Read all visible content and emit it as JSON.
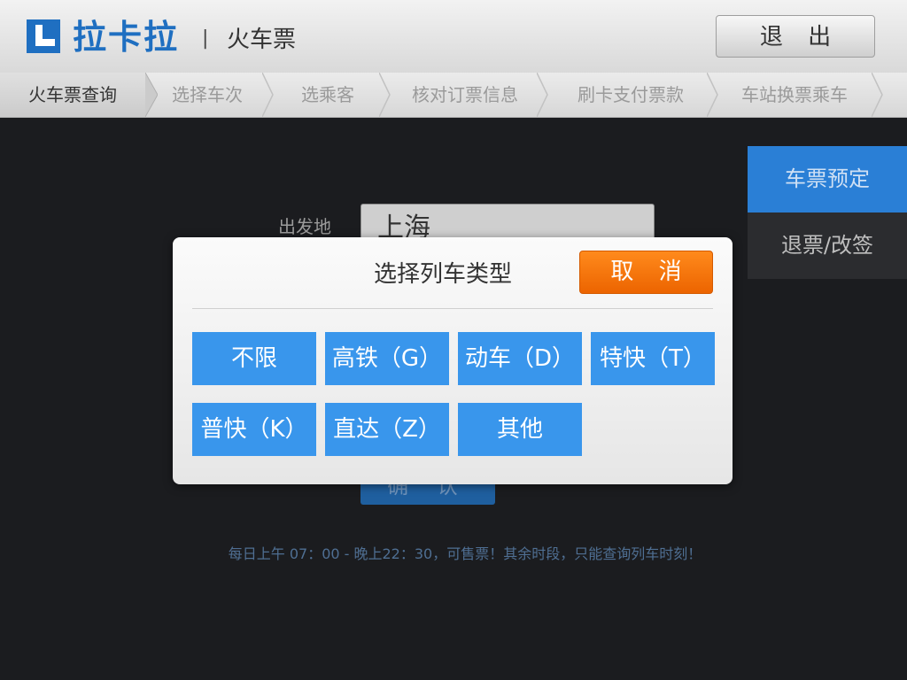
{
  "header": {
    "brand": "拉卡拉",
    "separator": "|",
    "subtitle": "火车票",
    "exit_label": "退 出"
  },
  "steps": [
    {
      "label": "火车票查询",
      "active": true
    },
    {
      "label": "选择车次",
      "active": false
    },
    {
      "label": "选乘客",
      "active": false
    },
    {
      "label": "核对订票信息",
      "active": false
    },
    {
      "label": "刷卡支付票款",
      "active": false
    },
    {
      "label": "车站换票乘车",
      "active": false
    }
  ],
  "side_menu": {
    "items": [
      {
        "label": "车票预定",
        "active": true
      },
      {
        "label": "退票/改签",
        "active": false
      }
    ]
  },
  "form": {
    "origin_label": "出发地",
    "origin_value": "上海",
    "confirm_label": "确 认"
  },
  "notice": "每日上午 07：00 - 晚上22：30，可售票！其余时段，只能查询列车时刻！",
  "modal": {
    "title": "选择列车类型",
    "cancel_label": "取 消",
    "options": [
      "不限",
      "高铁（G）",
      "动车（D）",
      "特快（T）",
      "普快（K）",
      "直达（Z）",
      "其他"
    ]
  },
  "colors": {
    "brand_blue": "#1f6fc1",
    "option_blue": "#3996ec",
    "cancel_orange": "#f57400",
    "side_active": "#2a7fd6"
  }
}
